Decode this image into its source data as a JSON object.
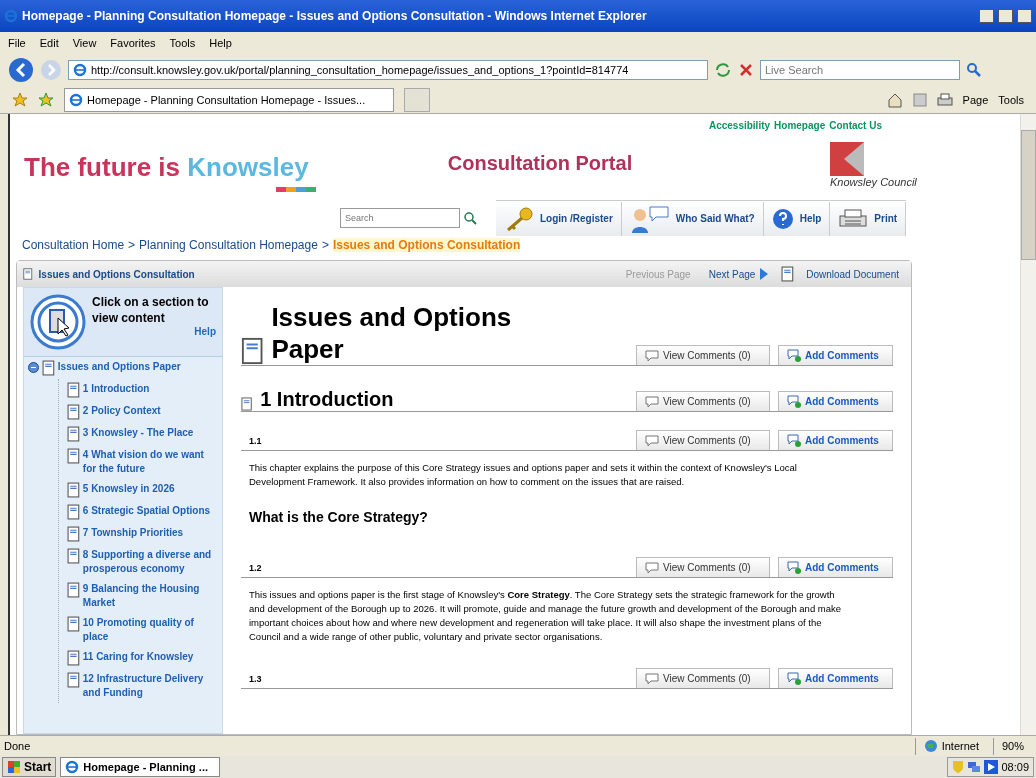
{
  "window": {
    "title": "Homepage - Planning Consultation Homepage - Issues and Options Consultation - Windows Internet Explorer"
  },
  "menu": [
    "File",
    "Edit",
    "View",
    "Favorites",
    "Tools",
    "Help"
  ],
  "address": {
    "url": "http://consult.knowsley.gov.uk/portal/planning_consultation_homepage/issues_and_options_1?pointId=814774",
    "search_placeholder": "Live Search"
  },
  "tab": {
    "title": "Homepage - Planning Consultation Homepage - Issues..."
  },
  "command_bar": [
    "Page",
    "Tools"
  ],
  "site": {
    "top_links": [
      "Accessibility",
      "Homepage",
      "Contact Us"
    ],
    "logo_prefix": "The future is ",
    "logo_name": "Knowsley",
    "portal_title": "Consultation Portal",
    "council": "Knowsley Council",
    "search_placeholder": "Search",
    "toolbar": [
      {
        "kind": "login",
        "label": "Login /Register"
      },
      {
        "kind": "people",
        "label": "Who Said What?"
      },
      {
        "kind": "help",
        "label": "Help"
      },
      {
        "kind": "print",
        "label": "Print"
      }
    ]
  },
  "breadcrumbs": [
    {
      "kind": "link",
      "label": "Consultation Home"
    },
    {
      "kind": "separator",
      "label": ">"
    },
    {
      "kind": "link",
      "label": "Planning Consultation Homepage"
    },
    {
      "kind": "separator",
      "label": ">"
    },
    {
      "kind": "current",
      "label": "Issues and Options Consultation"
    }
  ],
  "panel": {
    "title": "Issues and Options Consultation",
    "previous": {
      "label": "Previous Page",
      "disabled": true
    },
    "next": {
      "label": "Next Page",
      "disabled": false
    },
    "download": "Download Document"
  },
  "sidebar": {
    "prompt": "Click on a section to view content",
    "help": "Help",
    "tree": [
      {
        "label": "Issues and Options Paper",
        "expanded": true,
        "children": [
          {
            "label": "1 Introduction"
          },
          {
            "label": "2 Policy Context"
          },
          {
            "label": "3 Knowsley - The Place"
          },
          {
            "label": "4 What vision do we want for the future"
          },
          {
            "label": "5 Knowsley in 2026"
          },
          {
            "label": "6 Strategic Spatial Options"
          },
          {
            "label": "7 Township Priorities"
          },
          {
            "label": "8 Supporting a diverse and prosperous economy"
          },
          {
            "label": "9 Balancing the Housing Market"
          },
          {
            "label": "10 Promoting quality of place"
          },
          {
            "label": "11 Caring for Knowsley"
          },
          {
            "label": "12 Infrastructure Delivery and Funding"
          }
        ]
      }
    ]
  },
  "content": [
    {
      "kind": "title",
      "text": "Issues and Options Paper",
      "view": "View Comments (0)",
      "add": "Add Comments"
    },
    {
      "kind": "section",
      "text": "1 Introduction",
      "view": "View Comments (0)",
      "add": "Add Comments"
    },
    {
      "kind": "number",
      "text": "1.1",
      "view": "View Comments (0)",
      "add": "Add Comments"
    },
    {
      "kind": "para",
      "text": "This chapter explains the purpose of this Core Strategy issues and options paper and sets it within the context of Knowsley's Local Development Framework. It also provides information on how to comment on the issues that are raised."
    },
    {
      "kind": "subheading",
      "text": "What is the Core Strategy?"
    },
    {
      "kind": "number",
      "text": "1.2",
      "view": "View Comments (0)",
      "add": "Add Comments"
    },
    {
      "kind": "para",
      "text": "This issues and options paper is the first stage of Knowsley's **Core Strategy**. The Core Strategy sets the strategic framework for the growth and development of the Borough up to 2026. It will promote, guide and manage the future growth and development of the Borough and make important choices about how and where new development and regeneration will take place. It will also shape the investment plans of the Council and a wide range of other public, voluntary and private sector organisations."
    },
    {
      "kind": "number",
      "text": "1.3",
      "view": "View Comments (0)",
      "add": "Add Comments"
    }
  ],
  "status_bar": {
    "text": "Done",
    "zone": "Internet",
    "zoom": "90%"
  },
  "taskbar": {
    "start": "Start",
    "task": "Homepage - Planning ...",
    "clock": "08:09"
  }
}
